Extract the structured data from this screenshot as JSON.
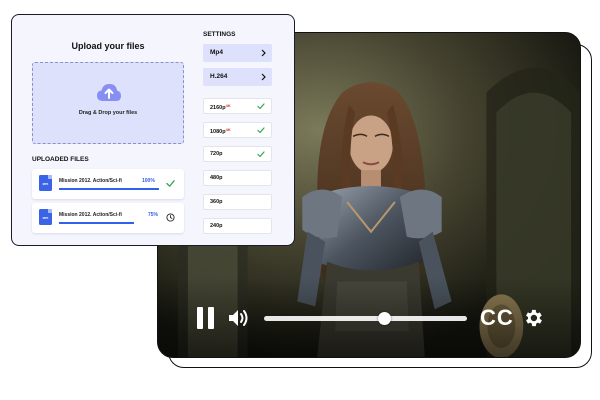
{
  "upload_panel": {
    "title": "Upload your files",
    "dropzone_text": "Drag & Drop your files",
    "uploaded_heading": "UPLOADED FILES",
    "files": [
      {
        "name": "Mission 2012. Action/Sci-fi",
        "percent": "100%",
        "progress": 1.0,
        "ext": "MP4",
        "status_icon": "check-icon"
      },
      {
        "name": "Mission 2012. Action/Sci-fi",
        "percent": "75%",
        "progress": 0.75,
        "ext": "MP4",
        "status_icon": "clock-icon"
      }
    ]
  },
  "settings": {
    "heading": "SETTINGS",
    "format": "Mp4",
    "codec": "H.264",
    "resolutions": [
      {
        "label": "2160p",
        "badge": "4K",
        "selected": true
      },
      {
        "label": "1080p",
        "badge": "4K",
        "selected": true
      },
      {
        "label": "720p",
        "badge": "",
        "selected": true
      },
      {
        "label": "480p",
        "badge": "",
        "selected": false
      },
      {
        "label": "360p",
        "badge": "",
        "selected": false
      },
      {
        "label": "240p",
        "badge": "",
        "selected": false
      }
    ]
  },
  "player": {
    "progress": 0.59,
    "cc_label": "CC",
    "icons": [
      "pause-icon",
      "volume-icon",
      "gear-icon"
    ]
  },
  "colors": {
    "accent": "#2f62ea",
    "panel_bg": "#f4f5fd",
    "dropzone_bg": "#dee1fc",
    "badge_red": "#e0322b",
    "check_green": "#2fa84f"
  }
}
